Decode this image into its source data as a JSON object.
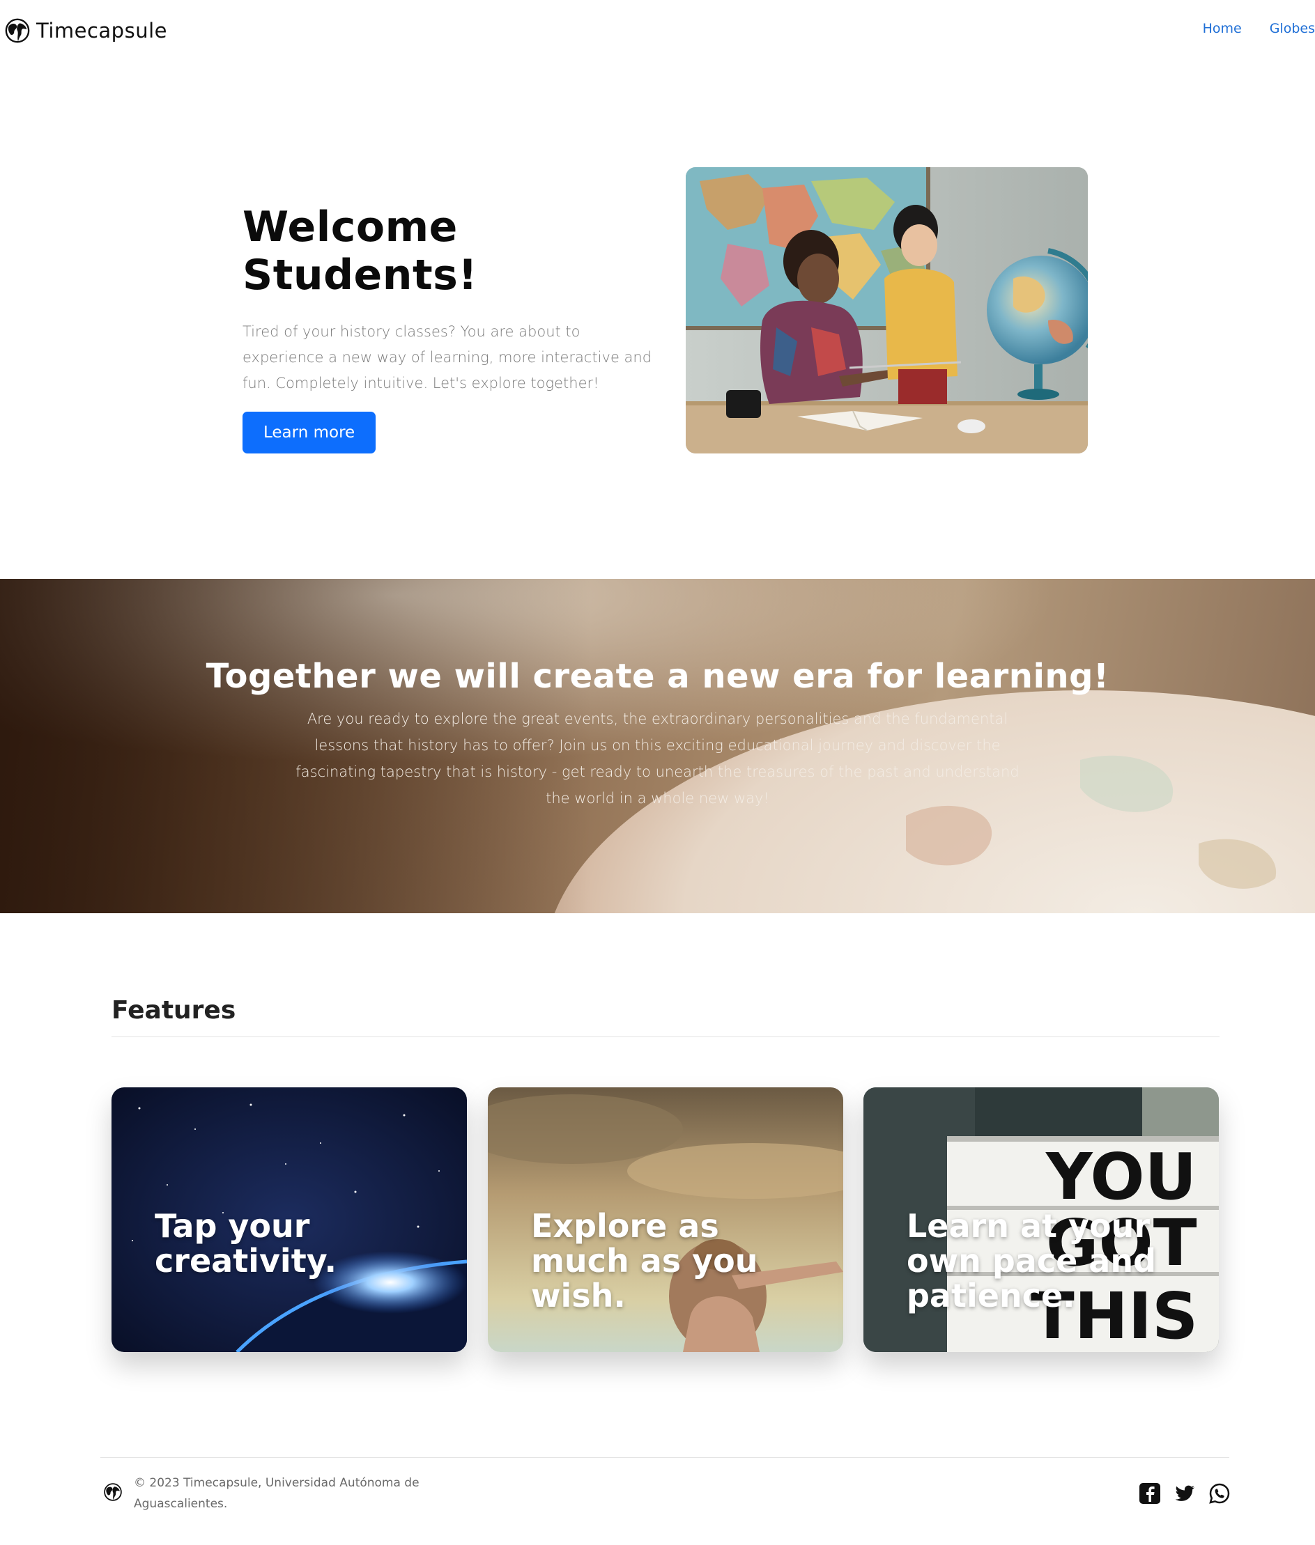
{
  "header": {
    "brand": "Timecapsule",
    "nav": [
      {
        "label": "Home"
      },
      {
        "label": "Globes"
      }
    ]
  },
  "hero": {
    "title": "Welcome Students!",
    "lead": "Tired of your history classes? You are about to experience a new way of learning, more interactive and fun. Completely intuitive. Let's explore together!",
    "button": "Learn more",
    "image_alt_icon": "teacher-student-globe-photo"
  },
  "banner": {
    "title": "Together we will create a new era for learning!",
    "text": "Are you ready to explore the great events, the extraordinary personalities and the fundamental lessons that history has to offer? Join us on this exciting educational journey and discover the fascinating tapestry that is history - get ready to unearth the treasures of the past and understand the world in a whole new way!"
  },
  "features": {
    "title": "Features",
    "cards": [
      {
        "title": "Tap your creativity.",
        "image_icon": "earth-from-space-photo"
      },
      {
        "title": "Explore as much as you wish.",
        "image_icon": "woman-looking-horizon-photo"
      },
      {
        "title": "Learn at your own pace and patience.",
        "image_icon": "you-got-this-sign-photo",
        "sign_text": [
          "YOU",
          "GOT",
          "THIS"
        ]
      }
    ]
  },
  "footer": {
    "copyright": "© 2023 Timecapsule, Universidad Autónoma de Aguascalientes.",
    "social": [
      "facebook-icon",
      "twitter-icon",
      "whatsapp-icon"
    ]
  },
  "colors": {
    "primary": "#0d6efd",
    "link": "#1f6fd6"
  }
}
